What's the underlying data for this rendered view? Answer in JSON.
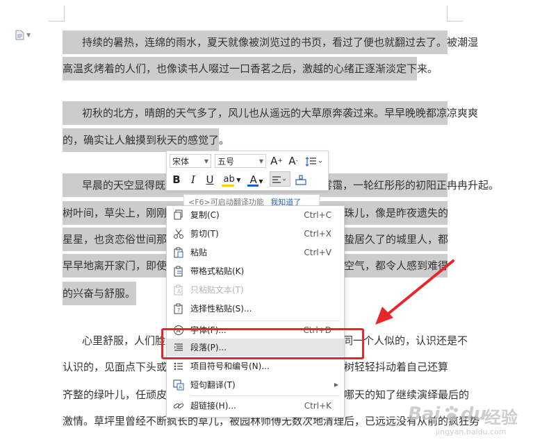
{
  "document": {
    "lines": [
      "持续的暑热，连绵的雨水，夏天就像被浏览过的书页，看过了便也就翻过去了。被潮湿",
      "高温炙烤着的人们，也像读书人啜过一口香茗之后，激越的心绪正逐渐淡定下来。",
      "初秋的北方，晴朗的天气多了，风儿也从遥远的大草原奔袭过来。早早晚晚都凉凉爽爽",
      "的，确实让人触摸到秋天的感觉了。",
      "早晨的天空显得既高且远，东面的树梢间腾起薄薄的雾霭，一轮红彤彤的初阳正冉冉升起。",
      "树叶间，草尖上，刚刚绽开的花朵上，都挂满了晶莹剔透的露珠儿，像是昨夜遗失的",
      "星星，也贪恋俗世间那点儿烟火气息，舍不得离开。就连那些蛰居久了的城里人，都",
      "早早地离开家门，即使什么也不做，单是呼吸一下清凉湿润的空气，都令人感到难得",
      "的兴奋与舒服。",
      "心里舒服，人们脸上便也多了笑容。相遇时点点头，像是同一个人似的，认识还是不",
      "认识的，见面点下头或是微笑一下，都是很自然的事情。杨柳树轻轻抖动着自己还算",
      "齐整的绿叶儿，任顽皮的风儿在枝间穿梭嬉戏，秋蝉也不知从哪天的知了继续演绎最后的",
      "激情。草坪里曾经不断疯长的草儿，被园林师傅无数次地清理后，已远远没有从前的疯狂势"
    ]
  },
  "mini_toolbar": {
    "font_name": "宋体",
    "font_size": "五号",
    "grow_font": "A",
    "shrink_font": "A",
    "bold": "B",
    "italic": "I",
    "highlight": "ab",
    "font_color": "A",
    "highlight_color": "#ffd200",
    "font_color_value": "#1e5bd6"
  },
  "translate_tip": {
    "text": "<F6>可启动翻译功能",
    "dismiss": "我知道了"
  },
  "context_menu": {
    "items": [
      {
        "label": "复制(C)",
        "shortcut": "Ctrl+C",
        "icon": "copy-icon"
      },
      {
        "label": "剪切(T)",
        "shortcut": "Ctrl+X",
        "icon": "scissors-icon"
      },
      {
        "label": "粘贴",
        "shortcut": "Ctrl+V",
        "icon": "paste-icon"
      },
      {
        "label": "带格式粘贴(K)",
        "shortcut": "",
        "icon": "paste-format-icon"
      },
      {
        "label": "只粘贴文本(T)",
        "shortcut": "",
        "icon": "paste-text-icon"
      },
      {
        "label": "选择性粘贴(S)...",
        "shortcut": "",
        "icon": "paste-special-icon"
      },
      {
        "label": "字体(F)...",
        "shortcut": "Ctrl+D",
        "icon": "font-icon"
      },
      {
        "label": "段落(P)...",
        "shortcut": "",
        "icon": "paragraph-icon"
      },
      {
        "label": "项目符号和编号(N)...",
        "shortcut": "",
        "icon": "bullets-icon"
      },
      {
        "label": "短句翻译(T)",
        "shortcut": "",
        "icon": "translate-icon"
      },
      {
        "label": "超链接(H)...",
        "shortcut": "Ctrl+K",
        "icon": "link-icon"
      }
    ]
  },
  "watermark": {
    "brand": "Bai",
    "du": "du",
    "jingyan": "经验",
    "url": "jingyan.baidu.com"
  }
}
